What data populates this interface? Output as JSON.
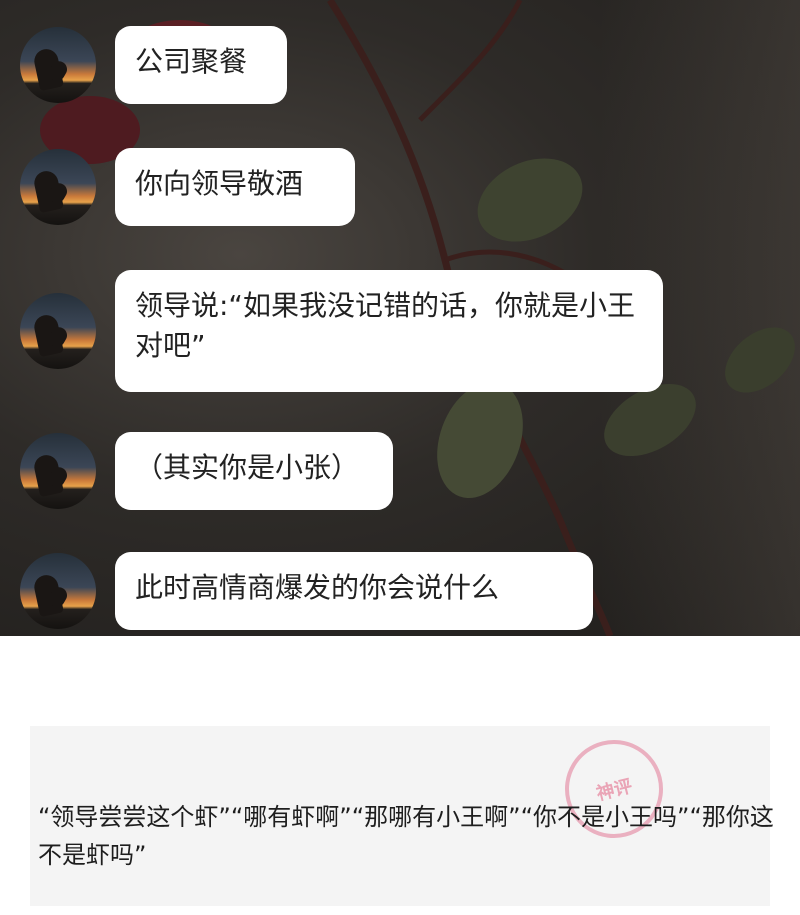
{
  "chat": {
    "messages": [
      {
        "text": "公司聚餐"
      },
      {
        "text": "你向领导敬酒"
      },
      {
        "text": "领导说:“如果我没记错的话，你就是小王对吧”"
      },
      {
        "text": "（其实你是小张）"
      },
      {
        "text": "此时高情商爆发的你会说什么"
      }
    ]
  },
  "comment": {
    "text": "“领导尝尝这个虾”“哪有虾啊”“那哪有小王啊”“你不是小王吗”“那你这不是虾吗”"
  },
  "watermark": {
    "text": "神评",
    "color": "#e2788f"
  }
}
